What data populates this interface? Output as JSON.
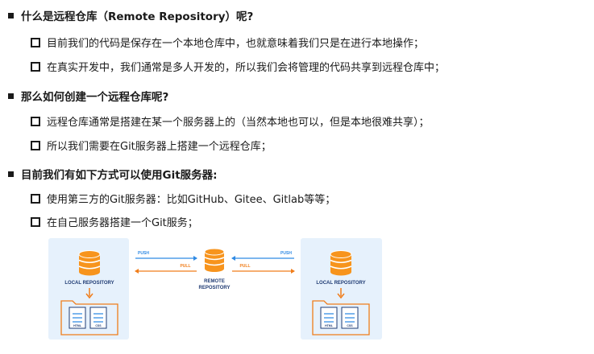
{
  "sections": [
    {
      "heading": "什么是远程仓库（Remote Repository）呢?",
      "items": [
        "目前我们的代码是保存在一个本地仓库中，也就意味着我们只是在进行本地操作；",
        "在真实开发中，我们通常是多人开发的，所以我们会将管理的代码共享到远程仓库中；"
      ]
    },
    {
      "heading": "那么如何创建一个远程仓库呢?",
      "items": [
        "远程仓库通常是搭建在某一个服务器上的（当然本地也可以，但是本地很难共享）；",
        "所以我们需要在Git服务器上搭建一个远程仓库；"
      ]
    },
    {
      "heading": "目前我们有如下方式可以使用Git服务器:",
      "items": [
        "使用第三方的Git服务器：比如GitHub、Gitee、Gitlab等等；",
        "在自己服务器搭建一个Git服务；"
      ]
    }
  ],
  "diagram": {
    "left_label": "LOCAL REPOSITORY",
    "right_label": "LOCAL REPOSITORY",
    "center_label_line1": "REMOTE",
    "center_label_line2": "REPOSITORY",
    "push_label": "PUSH",
    "pull_label": "PULL",
    "file1": "HTML",
    "file2": "CSS",
    "colors": {
      "panel": "#e6f1fc",
      "database": "#f7941d",
      "push_arrow": "#2f8ae4",
      "pull_arrow": "#f07d1a",
      "label": "#1f3b73"
    }
  }
}
